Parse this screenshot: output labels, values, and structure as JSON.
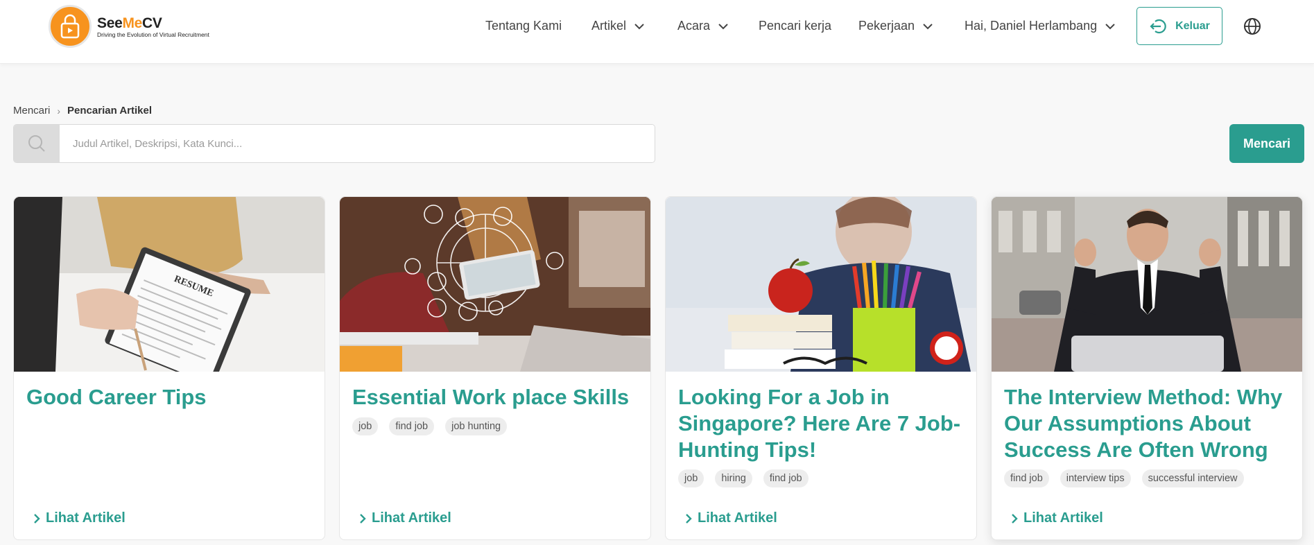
{
  "brand": {
    "name_part1": "See",
    "name_part2": "Me",
    "name_part3": "CV",
    "tagline": "Driving the Evolution of Virtual Recruitment"
  },
  "nav": {
    "about": "Tentang Kami",
    "articles": "Artikel",
    "events": "Acara",
    "job_seekers": "Pencari kerja",
    "jobs": "Pekerjaan",
    "greeting": "Hai, Daniel Herlambang",
    "logout": "Keluar"
  },
  "breadcrumb": {
    "root": "Mencari",
    "current": "Pencarian Artikel"
  },
  "search": {
    "value": "",
    "placeholder": "Judul Artikel, Deskripsi, Kata Kunci...",
    "button": "Mencari"
  },
  "colors": {
    "accent": "#2a9d8f",
    "brand_orange": "#f7931e"
  },
  "articles": [
    {
      "title": "Good Career Tips",
      "tags": [],
      "link": "Lihat Artikel"
    },
    {
      "title": "Essential Work place Skills",
      "tags": [
        "job",
        "find job",
        "job hunting"
      ],
      "link": "Lihat Artikel"
    },
    {
      "title": "Looking For a Job in Singapore? Here Are 7 Job-Hunting Tips!",
      "tags": [
        "job",
        "hiring",
        "find job"
      ],
      "link": "Lihat Artikel"
    },
    {
      "title": "The Interview Method: Why Our Assumptions About Success Are Often Wrong",
      "tags": [
        "find job",
        "interview tips",
        "successful interview"
      ],
      "link": "Lihat Artikel"
    }
  ]
}
